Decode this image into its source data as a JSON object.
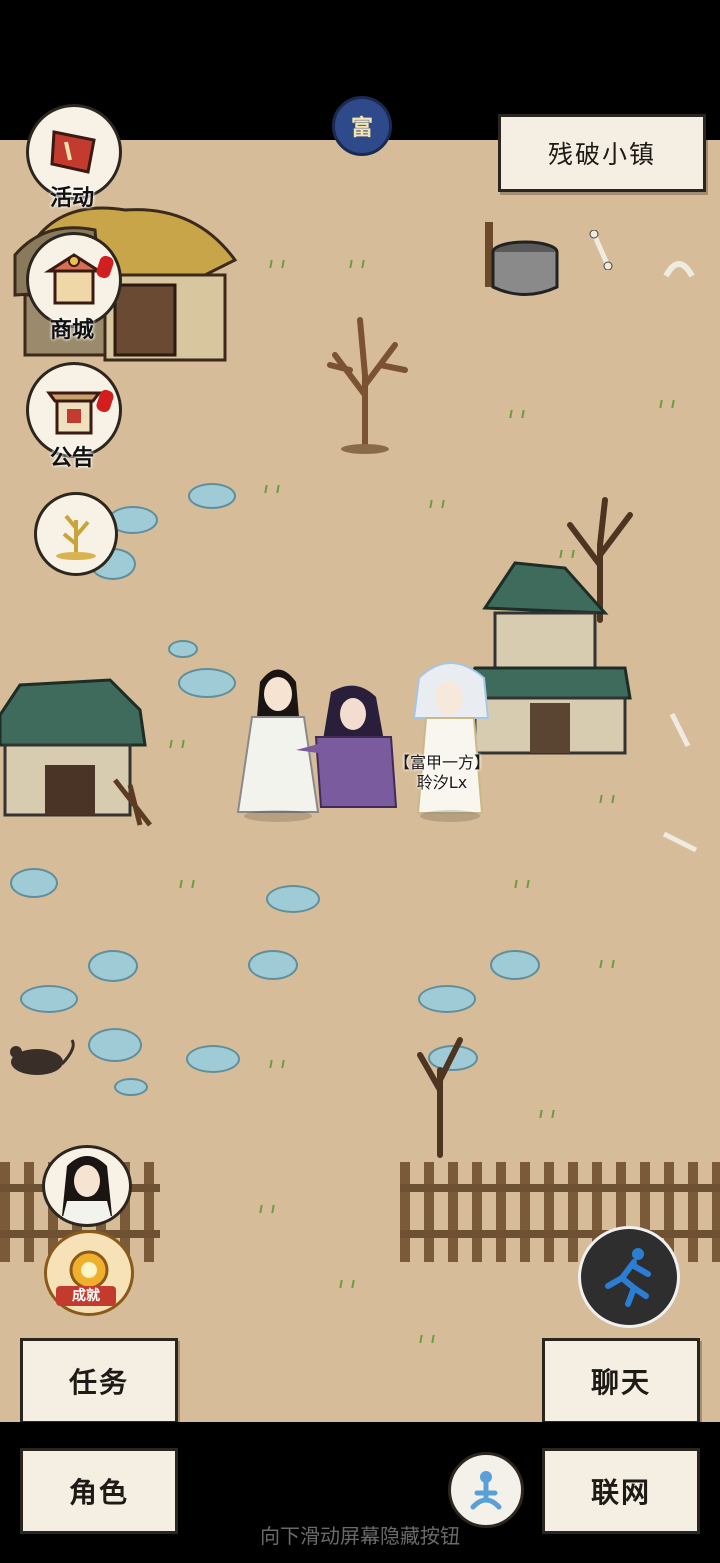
{
  "location": {
    "name": "残破小镇"
  },
  "top": {
    "badge_char": "富"
  },
  "side_menu": {
    "activity": "活动",
    "shop": "商城",
    "notice": "公告"
  },
  "player": {
    "title": "【富甲一方】",
    "name": "聆汐Lx"
  },
  "achievement": {
    "label": "成就"
  },
  "buttons": {
    "tasks": "任务",
    "chat": "聊天",
    "character": "角色",
    "online": "联网"
  },
  "hint": "向下滑动屏幕隐藏按钮",
  "colors": {
    "ground": "#d6bc98",
    "water_stone": "#9fcbd6",
    "roof_green": "#3f6b5c",
    "paper": "#f5efe3",
    "alert_red": "#d21e1e",
    "run_blue": "#2a7fd4"
  }
}
